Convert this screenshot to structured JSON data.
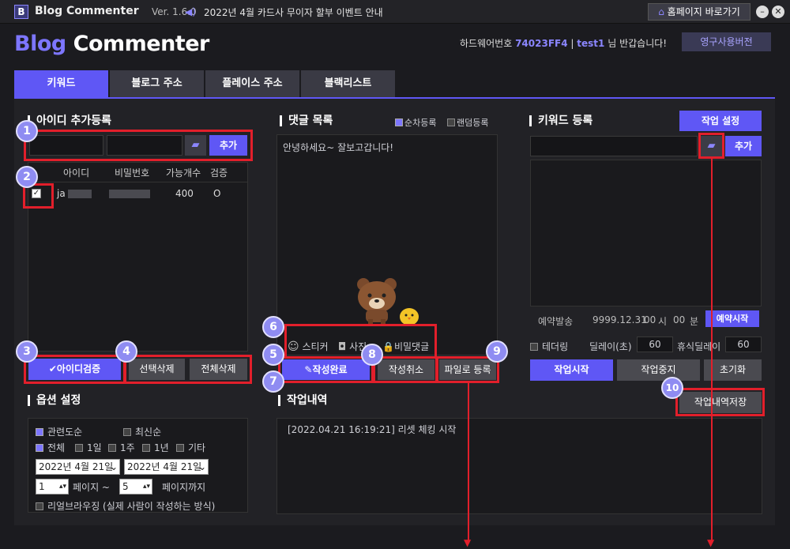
{
  "titlebar": {
    "logo_letter": "B",
    "app_name": "Blog Commenter",
    "version": "Ver. 1.6.0",
    "notice": "2022년 4월 카드사 무이자 할부 이벤트 안내",
    "home_button": "홈페이지 바로가기",
    "minimize": "–",
    "close": "✕"
  },
  "header": {
    "title_part1": "Blog",
    "title_part2": "Commenter",
    "hw_label": "하드웨어번호",
    "hw_code": "74023FF4",
    "separator": "|",
    "user": "test1",
    "greeting": "님 반갑습니다!",
    "permanent_button": "영구사용버전"
  },
  "tabs": [
    {
      "label": "키워드",
      "active": true
    },
    {
      "label": "블로그 주소",
      "active": false
    },
    {
      "label": "플레이스 주소",
      "active": false
    },
    {
      "label": "블랙리스트",
      "active": false
    }
  ],
  "account": {
    "section_title": "아이디 추가등록",
    "add_button": "추가",
    "columns": [
      "아이디",
      "비밀번호",
      "가능개수",
      "검증"
    ],
    "rows": [
      {
        "id": "ja",
        "password": "",
        "count": "400",
        "verify": "O",
        "checked": true
      }
    ],
    "verify_button": "아이디검증",
    "delete_selected": "선택삭제",
    "delete_all": "전체삭제"
  },
  "comments": {
    "section_title": "댓글 목록",
    "opt_sequential": "순차등록",
    "opt_random": "랜덤등록",
    "sample_text": "안녕하세요~ 잘보고갑니다!",
    "sticker": "스티커",
    "photo": "사진",
    "secret": "비밀댓글",
    "complete_button": "작성완료",
    "cancel_button": "작성취소",
    "file_button": "파일로 등록"
  },
  "keyword": {
    "section_title": "키워드 등록",
    "settings_button": "작업 설정",
    "add_button": "추가",
    "reserve_label": "예약발송",
    "reserve_date": "9999.12.31",
    "hour_val": "00",
    "hour_label": "시",
    "min_val": "00",
    "min_label": "분",
    "reserve_button": "예약시작",
    "tethering": "테더링",
    "delay_label": "딜레이(초)",
    "delay_val": "60",
    "rest_label": "휴식딜레이",
    "rest_val": "60",
    "start_button": "작업시작",
    "stop_button": "작업중지",
    "reset_button": "초기화",
    "save_log_button": "작업내역저장"
  },
  "options": {
    "section_title": "옵션 설정",
    "sort_related": "관련도순",
    "sort_recent": "최신순",
    "period_all": "전체",
    "period_1d": "1일",
    "period_1w": "1주",
    "period_1y": "1년",
    "period_etc": "기타",
    "date_from": "2022년  4월 21일",
    "date_to": "2022년  4월 21일",
    "page_from": "1",
    "page_from_label": "페이지 ~",
    "page_to": "5",
    "page_to_label": "페이지까지",
    "real_browsing": "리얼브라우징 (실제 사람이 작성하는 방식)"
  },
  "log": {
    "section_title": "작업내역",
    "entries": [
      "[2022.04.21 16:19:21]  리셋 체킹 시작"
    ]
  },
  "badges": [
    "1",
    "2",
    "3",
    "4",
    "5",
    "6",
    "7",
    "8",
    "9",
    "10"
  ],
  "colors": {
    "accent": "#5f57f5",
    "annotation_red": "#e21f2b",
    "badge": "#8f8cf2"
  }
}
